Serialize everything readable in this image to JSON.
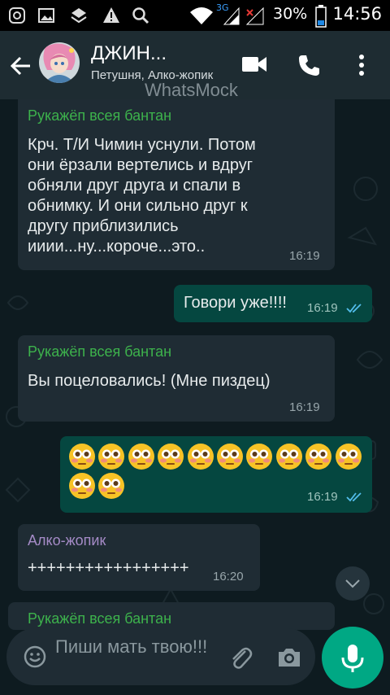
{
  "status_bar": {
    "network_3g": "3G",
    "battery": "30%",
    "time": "14:56"
  },
  "header": {
    "title": "ДЖИН...",
    "subtitle": "Петушня, Алко-жопик",
    "watermark": "WhatsMock",
    "icons": [
      "back-arrow-icon",
      "video-call-icon",
      "phone-icon",
      "more-vert-icon"
    ]
  },
  "messages": [
    {
      "direction": "incoming",
      "sender": "Рукажёп всея бантан",
      "lines": [
        "Крч. Т/И Чимин уснули. Потом",
        "они ёрзали вертелись и вдруг",
        "обняли друг друга и спали в",
        "обнимку. И они сильно друг к",
        "другу приблизились",
        "ииии...ну...короче...это.."
      ],
      "time": "16:19"
    },
    {
      "direction": "outgoing",
      "text": "Говори уже!!!!",
      "time": "16:19",
      "status": "read"
    },
    {
      "direction": "incoming",
      "sender": "Рукажёп всея бантан",
      "text": "Вы поцеловались! (Мне пиздец)",
      "time": "16:19"
    },
    {
      "direction": "outgoing",
      "emoji_count": 12,
      "time": "16:19",
      "status": "read"
    },
    {
      "direction": "incoming",
      "sender": "Алко-жопик",
      "text": "+++++++++++++++++",
      "time": "16:20"
    },
    {
      "direction": "incoming",
      "sender": "Рукажёп всея бантан",
      "partial": true
    }
  ],
  "composer": {
    "placeholder": "Пиши мать твою!!!"
  },
  "colors": {
    "incoming_bubble": "#1f2c34",
    "outgoing_bubble": "#054740",
    "sender_green": "#3db24c",
    "sender_purple": "#a58bc7",
    "accent": "#00a884",
    "read_ticks": "#53bdeb"
  }
}
